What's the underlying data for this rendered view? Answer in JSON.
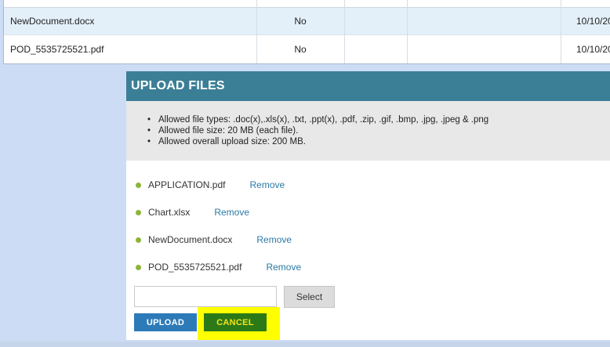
{
  "files_table": {
    "rows": [
      {
        "name": "NewDocument.docx",
        "flag": "No",
        "date": "10/10/20"
      },
      {
        "name": "POD_5535725521.pdf",
        "flag": "No",
        "date": "10/10/20"
      }
    ]
  },
  "upload": {
    "title": "UPLOAD FILES",
    "rules": [
      "Allowed file types: .doc(x),.xls(x), .txt, .ppt(x), .pdf, .zip, .gif, .bmp, .jpg, .jpeg & .png",
      "Allowed file size: 20 MB (each file).",
      "Allowed overall upload size: 200 MB."
    ],
    "files": [
      {
        "name": "APPLICATION.pdf",
        "remove_label": "Remove"
      },
      {
        "name": "Chart.xlsx",
        "remove_label": "Remove"
      },
      {
        "name": "NewDocument.docx",
        "remove_label": "Remove"
      },
      {
        "name": "POD_5535725521.pdf",
        "remove_label": "Remove"
      }
    ],
    "file_input_value": "",
    "select_label": "Select",
    "upload_label": "UPLOAD",
    "cancel_label": "CANCEL"
  },
  "colors": {
    "header_bg": "#3b7f96",
    "upload_button": "#2d7ab8",
    "cancel_button": "#2c7a17",
    "cancel_text": "#f3e41a",
    "highlight": "#ffff00",
    "bullet": "#8cb43a",
    "link": "#2a7aa6"
  }
}
